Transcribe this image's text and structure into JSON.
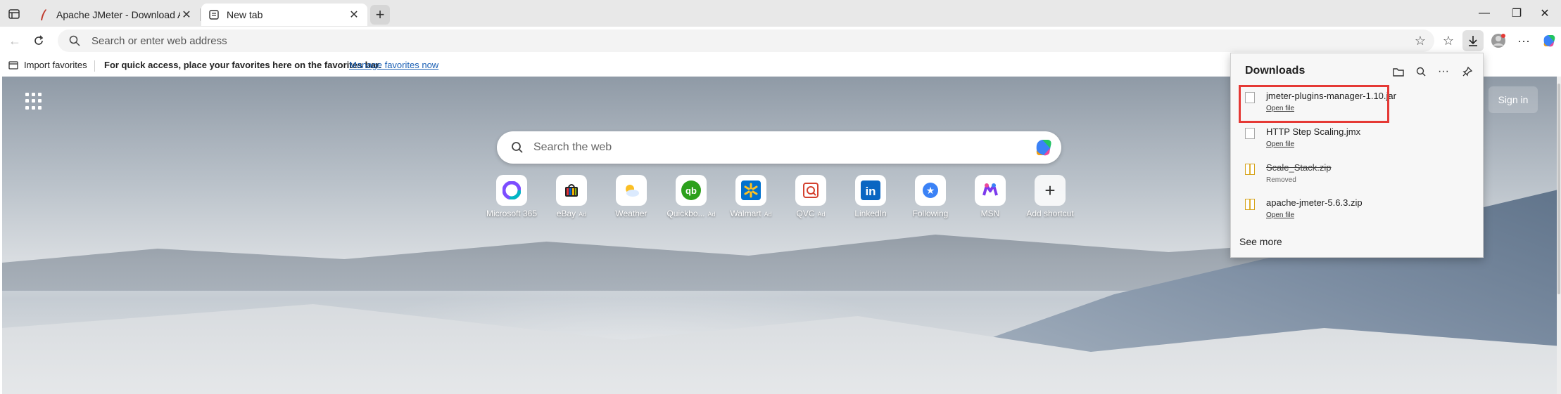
{
  "tabs": [
    {
      "title": "Apache JMeter - Download Apache JMeter",
      "active": false
    },
    {
      "title": "New tab",
      "active": true
    }
  ],
  "toolbar": {
    "address_placeholder": "Search or enter web address"
  },
  "favorites_bar": {
    "import_label": "Import favorites",
    "hint_text": "For quick access, place your favorites here on the favorites bar.",
    "manage_link": "Manage favorites now"
  },
  "newtab": {
    "signin_label": "Sign in",
    "search_placeholder": "Search the web",
    "shortcuts": [
      {
        "label": "Microsoft 365",
        "ad": "",
        "icon": "microsoft-365-icon"
      },
      {
        "label": "eBay",
        "ad": "Ad",
        "icon": "ebay-icon"
      },
      {
        "label": "Weather",
        "ad": "",
        "icon": "weather-icon"
      },
      {
        "label": "Quickbo...",
        "ad": "Ad",
        "icon": "quickbooks-icon"
      },
      {
        "label": "Walmart",
        "ad": "Ad",
        "icon": "walmart-icon"
      },
      {
        "label": "QVC",
        "ad": "Ad",
        "icon": "qvc-icon"
      },
      {
        "label": "LinkedIn",
        "ad": "",
        "icon": "linkedin-icon"
      },
      {
        "label": "Following",
        "ad": "",
        "icon": "following-icon"
      },
      {
        "label": "MSN",
        "ad": "",
        "icon": "msn-icon"
      },
      {
        "label": "Add shortcut",
        "ad": "",
        "icon": "add-icon"
      }
    ]
  },
  "downloads": {
    "title": "Downloads",
    "items": [
      {
        "name": "jmeter-plugins-manager-1.10.jar",
        "status": "Open file"
      },
      {
        "name": "HTTP Step Scaling.jmx",
        "status": "Open file"
      },
      {
        "name": "Scale_Stack.zip",
        "status": "Removed"
      },
      {
        "name": "apache-jmeter-5.6.3.zip",
        "status": "Open file"
      }
    ],
    "see_more": "See more"
  }
}
